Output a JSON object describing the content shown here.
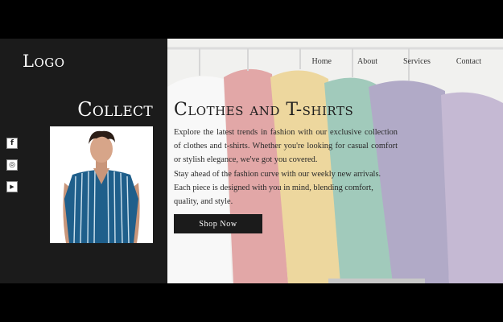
{
  "brand": {
    "logo": "Logo"
  },
  "nav": {
    "items": [
      "Home",
      "About",
      "Services",
      "Contact"
    ]
  },
  "sidebar": {
    "collect_label": "Collect",
    "socials": [
      {
        "icon": "facebook-icon",
        "glyph": "f"
      },
      {
        "icon": "instagram-icon",
        "glyph": "◎"
      },
      {
        "icon": "youtube-icon",
        "glyph": "▶"
      }
    ]
  },
  "hero": {
    "title": "Clothes and T-shirts",
    "paragraph1": "Explore the latest trends in fashion with our exclusive collection of clothes and t-shirts. Whether you're looking for casual comfort or stylish elegance, we've got you covered.",
    "paragraph2": "Stay ahead of the fashion curve with our weekly new arrivals. Each piece is designed with you in mind, blending comfort, quality, and style.",
    "cta_label": "Shop Now"
  },
  "colors": {
    "sidebar_bg": "#1b1b1b",
    "button_bg": "#1b1b1b",
    "shirt_stripe": "#1f5f8b"
  }
}
